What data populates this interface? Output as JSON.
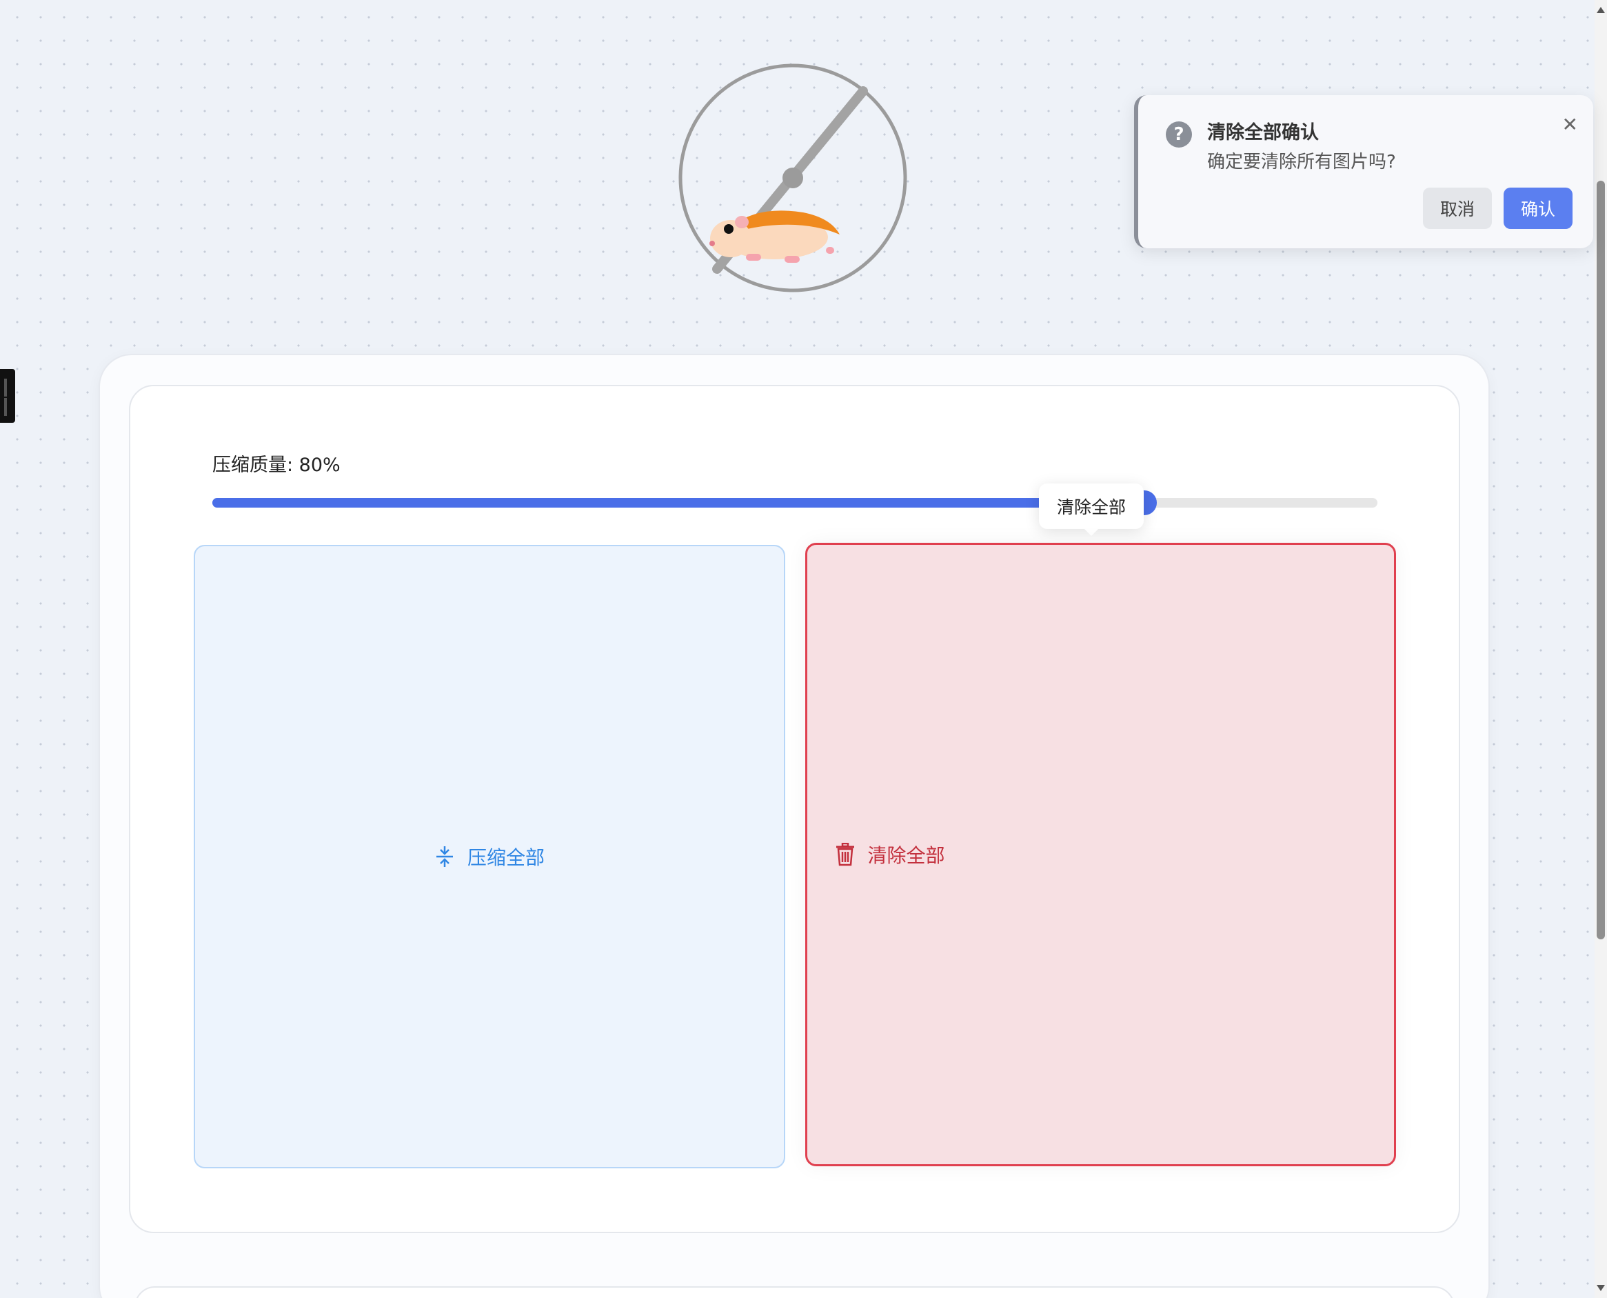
{
  "quality": {
    "label": "压缩质量: 80%",
    "value": 80
  },
  "tooltip": {
    "text": "清除全部"
  },
  "actions": {
    "compress_label": "压缩全部",
    "compress_icon": "compress-icon",
    "clear_label": "清除全部",
    "clear_icon": "trash-icon"
  },
  "popconfirm": {
    "icon": "question-icon",
    "title": "清除全部确认",
    "message": "确定要清除所有图片吗?",
    "cancel_label": "取消",
    "confirm_label": "确认",
    "close_icon": "close-icon"
  },
  "colors": {
    "accent": "#4a6ee8",
    "danger": "#e0404f",
    "info": "#2f86e4"
  }
}
